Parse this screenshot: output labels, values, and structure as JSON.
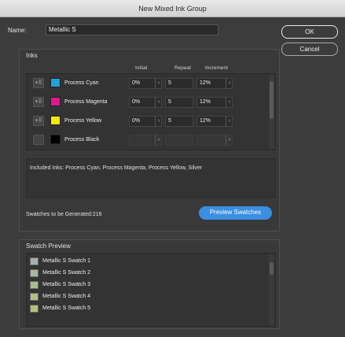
{
  "window": {
    "title": "New Mixed Ink Group"
  },
  "name_field": {
    "label": "Name:",
    "value": "Metallic S"
  },
  "buttons": {
    "ok": "OK",
    "cancel": "Cancel",
    "preview": "Preview Swatches"
  },
  "inks": {
    "title": "Inks",
    "columns": {
      "initial": "Initial",
      "repeat": "Repeat",
      "increment": "Increment"
    },
    "rows": [
      {
        "name": "Process Cyan",
        "color": "#1fa2dc",
        "initial": "0%",
        "repeat": "5",
        "increment": "12%",
        "enabled": true
      },
      {
        "name": "Process Magenta",
        "color": "#e0168f",
        "initial": "0%",
        "repeat": "5",
        "increment": "12%",
        "enabled": true
      },
      {
        "name": "Process Yellow",
        "color": "#f4ea0a",
        "initial": "0%",
        "repeat": "5",
        "increment": "12%",
        "enabled": true
      },
      {
        "name": "Process Black",
        "color": "#000000",
        "initial": "",
        "repeat": "",
        "increment": "",
        "enabled": false
      }
    ],
    "included": "Included Inks: Process Cyan, Process Magenta, Process Yellow, Silver",
    "generated": "Swatches to be Generated:216"
  },
  "swatch_preview": {
    "title": "Swatch Preview",
    "items": [
      {
        "name": "Metallic S Swatch 1",
        "color": "#a3b3ab"
      },
      {
        "name": "Metallic S Swatch 2",
        "color": "#a8b79c"
      },
      {
        "name": "Metallic S Swatch 3",
        "color": "#adbb8e"
      },
      {
        "name": "Metallic S Swatch 4",
        "color": "#b1bf80"
      },
      {
        "name": "Metallic S Swatch 5",
        "color": "#b5c170"
      }
    ]
  },
  "icons": {
    "ink_toggle": "ink-add-icon",
    "stepper": "chevron-right-icon"
  }
}
